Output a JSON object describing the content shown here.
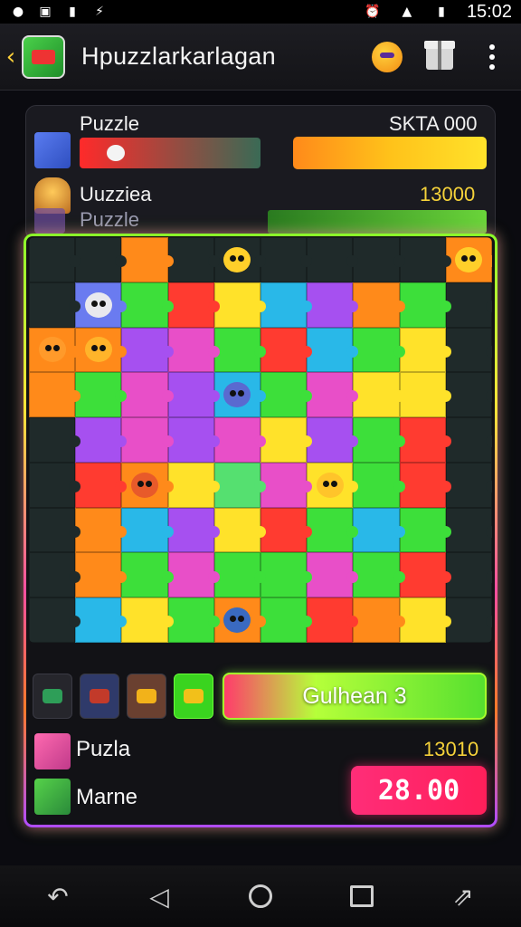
{
  "status_bar": {
    "time": "15:02",
    "icons": [
      "app-notification-icon",
      "gallery-icon",
      "file-icon",
      "usb-icon",
      "alarm-icon",
      "signal-icon",
      "battery-icon"
    ]
  },
  "app_bar": {
    "title": "Hpuzzlarkarlagan",
    "icons": [
      "back-icon",
      "app-logo",
      "mascot-icon",
      "gift-icon",
      "overflow-menu-icon"
    ]
  },
  "hud": {
    "row1_label": "Puzzle",
    "row1_value": "SKTA 000",
    "row2_label": "Uuzziea",
    "row2_value": "13000",
    "row3_label": "Puzzle",
    "colors": {
      "accent_yellow": "#ffd23a",
      "score_gold": "#f5d23a"
    }
  },
  "board": {
    "palette": [
      "#3ddf3a",
      "#29b8e8",
      "#ff3b30",
      "#ffe22a",
      "#ff8a1a",
      "#a650f0",
      "#e84fc8",
      "#55e070",
      "#6a7bf0",
      "#1f2a2a"
    ]
  },
  "controls": {
    "action_label": "Gulhean 3",
    "tools": [
      "lizard-icon",
      "rocket-icon",
      "snake-icon",
      "worm-icon"
    ]
  },
  "footer": {
    "row1_label": "Puzla",
    "row1_value": "13010",
    "row2_label": "Marne",
    "row2_score": "28.00"
  },
  "nav": {
    "icons": [
      "undo-icon",
      "back-triangle-icon",
      "home-circle-icon",
      "inbox-icon",
      "external-icon"
    ]
  }
}
